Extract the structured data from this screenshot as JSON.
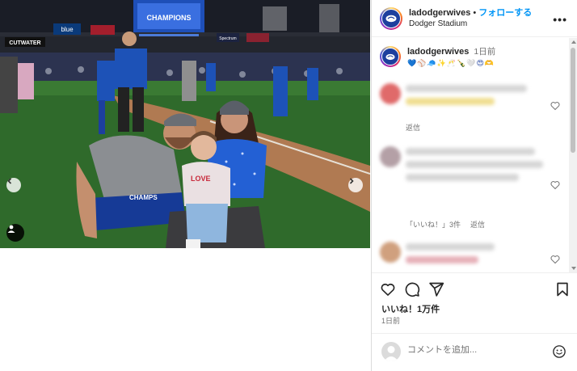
{
  "post": {
    "username": "ladodgerwives",
    "separator": "•",
    "follow_label": "フォローする",
    "location": "Dodger Stadium",
    "more_label": "•••"
  },
  "caption": {
    "username": "ladodgerwives",
    "time": "1日前",
    "emojis": "💙⚾🧢✨🥂🍾🤍😍🫶"
  },
  "comments": [
    {
      "reply_label": "返信"
    },
    {
      "reply_label": ""
    },
    {
      "reply_label": "返信",
      "likes_label": "「いいね！」3件"
    },
    {
      "reply_label": ""
    }
  ],
  "stats": {
    "likes": "いいね！1万件",
    "posted": "1日前"
  },
  "composer": {
    "placeholder": "コメントを追加..."
  },
  "scene": {
    "sign_cutwater": "CUTWATER",
    "sign_blue": "blue",
    "sign_scoreboard": "CHAMPIONS",
    "sign_spectrum": "Spectrum",
    "shirt_love": "LOVE",
    "shirt_champs": "CHAMPS"
  },
  "colors": {
    "accent": "#0095f6",
    "dodger_blue": "#1d3f9e",
    "grass": "#2f6a2b"
  },
  "icons": [
    "chevron-left-icon",
    "chevron-right-icon",
    "user-tag-icon",
    "heart-icon",
    "comment-icon",
    "share-icon",
    "bookmark-icon",
    "smiley-icon",
    "more-icon"
  ]
}
